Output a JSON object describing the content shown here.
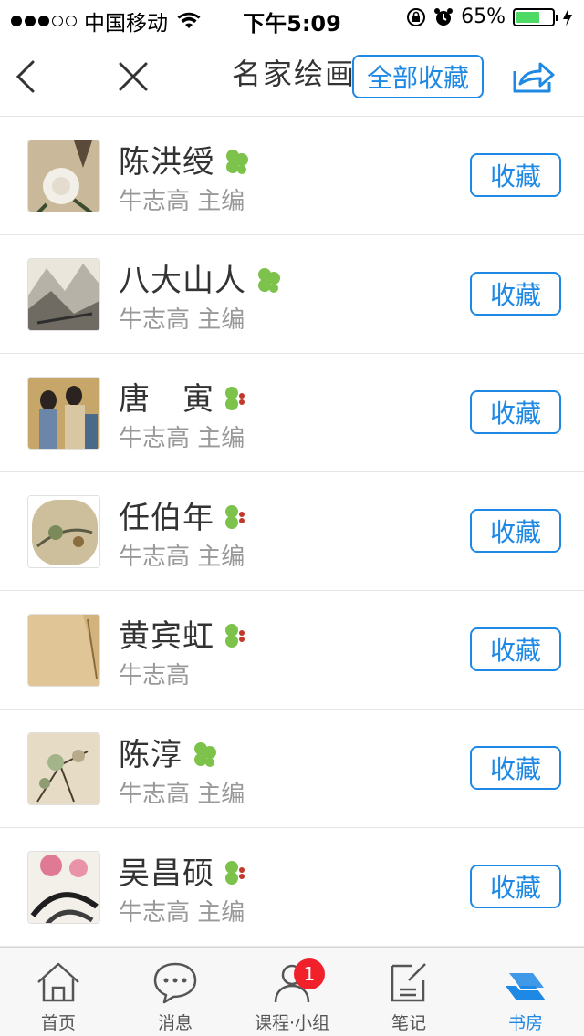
{
  "status_bar": {
    "carrier": "中国移动",
    "time": "下午5:09",
    "battery_pct": "65%",
    "battery_level": 0.65
  },
  "nav": {
    "title": "名家绘画",
    "fav_all_label": "全部收藏"
  },
  "items": [
    {
      "name": "陈洪绶",
      "editor": "牛志高 主编",
      "fav_label": "收藏",
      "leaf": "green"
    },
    {
      "name": "八大山人",
      "editor": "牛志高 主编",
      "fav_label": "收藏",
      "leaf": "green"
    },
    {
      "name": "唐　寅",
      "editor": "牛志高 主编",
      "fav_label": "收藏",
      "leaf": "red"
    },
    {
      "name": "任伯年",
      "editor": "牛志高 主编",
      "fav_label": "收藏",
      "leaf": "red"
    },
    {
      "name": "黄宾虹",
      "editor": "牛志高",
      "fav_label": "收藏",
      "leaf": "red"
    },
    {
      "name": "陈淳",
      "editor": "牛志高 主编",
      "fav_label": "收藏",
      "leaf": "green"
    },
    {
      "name": "吴昌硕",
      "editor": "牛志高 主编",
      "fav_label": "收藏",
      "leaf": "red"
    }
  ],
  "tabs": [
    {
      "label": "首页",
      "icon": "home-icon"
    },
    {
      "label": "消息",
      "icon": "chat-icon"
    },
    {
      "label": "课程·小组",
      "icon": "person-icon",
      "badge": "1"
    },
    {
      "label": "笔记",
      "icon": "note-icon"
    },
    {
      "label": "书房",
      "icon": "books-icon",
      "active": true
    }
  ],
  "colors": {
    "accent": "#1e88e5",
    "leaf_green": "#7dc24b",
    "leaf_red": "#c0392b",
    "badge": "#f0212b"
  }
}
